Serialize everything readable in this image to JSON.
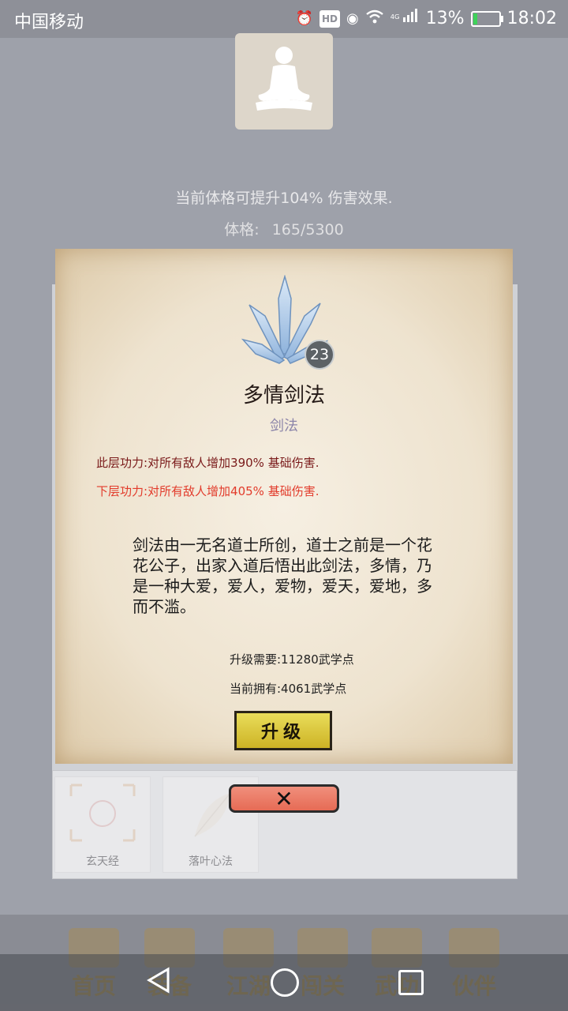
{
  "status_bar": {
    "carrier": "中国移动",
    "network": "4G",
    "battery_percent": "13%",
    "time": "18:02"
  },
  "header": {
    "boost_text": "当前体格可提升104% 伤害效果.",
    "physique_label": "体格:",
    "physique_value": "165/5300"
  },
  "skill": {
    "level": "23",
    "name": "多情剑法",
    "type": "剑法",
    "current_effect": "此层功力:对所有敌人增加390% 基础伤害.",
    "next_effect": "下层功力:对所有敌人增加405% 基础伤害.",
    "description": "剑法由一无名道士所创，道士之前是一个花花公子，出家入道后悟出此剑法，多情，乃是一种大爱，爱人，爱物，爱天，爱地，多而不滥。",
    "upgrade_required": "升级需要:11280武学点",
    "current_owned": "当前拥有:4061武学点",
    "upgrade_button": "升级",
    "close_button": "✕"
  },
  "skill_cards": [
    {
      "label": "玄天经"
    },
    {
      "label": "落叶心法"
    }
  ],
  "bottom_nav": [
    {
      "label": "首页"
    },
    {
      "label": "装备"
    },
    {
      "label": "江湖"
    },
    {
      "label": "闯关"
    },
    {
      "label": "武功"
    },
    {
      "label": "伙伴"
    }
  ],
  "colors": {
    "next_effect": "#e23b2b",
    "current_effect": "#7a1a1a",
    "upgrade_button": "#e0cf48",
    "close_button": "#ec7a64"
  }
}
